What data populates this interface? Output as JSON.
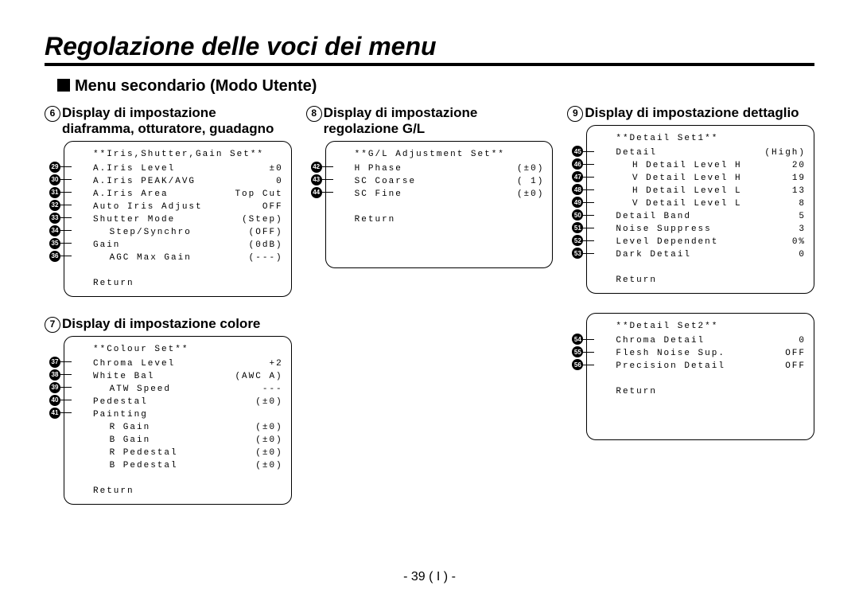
{
  "title": "Regolazione delle voci dei menu",
  "subhead": "Menu secondario (Modo Utente)",
  "footer": "- 39 ( I ) -",
  "sections": {
    "s6": {
      "num": "6",
      "title": "Display di impostazione diaframma, otturatore, guadagno",
      "header": "**Iris,Shutter,Gain Set**",
      "rows": [
        {
          "m": "29",
          "l": "A.Iris Level",
          "v": "±0"
        },
        {
          "m": "30",
          "l": "A.Iris PEAK/AVG",
          "v": "0"
        },
        {
          "m": "31",
          "l": "A.Iris Area",
          "v": "Top Cut"
        },
        {
          "m": "32",
          "l": "Auto Iris Adjust",
          "v": "OFF"
        },
        {
          "m": "33",
          "l": "Shutter Mode",
          "v": "(Step)"
        },
        {
          "m": "34",
          "l": " Step/Synchro",
          "v": "(OFF)",
          "indent": true
        },
        {
          "m": "35",
          "l": "Gain",
          "v": "(0dB)"
        },
        {
          "m": "36",
          "l": " AGC Max Gain",
          "v": "(---)",
          "indent": true
        }
      ],
      "return": "Return"
    },
    "s7": {
      "num": "7",
      "title": "Display di impostazione colore",
      "header": "**Colour Set**",
      "rows": [
        {
          "m": "37",
          "l": "Chroma Level",
          "v": "+2"
        },
        {
          "m": "38",
          "l": "White Bal",
          "v": "(AWC A)"
        },
        {
          "m": "39",
          "l": " ATW Speed",
          "v": "---",
          "indent": true
        },
        {
          "m": "40",
          "l": "Pedestal",
          "v": "(±0)"
        },
        {
          "m": "41",
          "l": "Painting",
          "v": ""
        },
        {
          "m": "",
          "l": " R Gain",
          "v": "(±0)",
          "indent": true
        },
        {
          "m": "",
          "l": " B Gain",
          "v": "(±0)",
          "indent": true
        },
        {
          "m": "",
          "l": " R Pedestal",
          "v": "(±0)",
          "indent": true
        },
        {
          "m": "",
          "l": " B Pedestal",
          "v": "(±0)",
          "indent": true
        }
      ],
      "return": "Return"
    },
    "s8": {
      "num": "8",
      "title": "Display di impostazione regolazione G/L",
      "header": "**G/L Adjustment Set**",
      "rows": [
        {
          "m": "42",
          "l": "H Phase",
          "v": "(±0)"
        },
        {
          "m": "43",
          "l": "SC Coarse",
          "v": "( 1)"
        },
        {
          "m": "44",
          "l": "SC Fine",
          "v": "(±0)"
        }
      ],
      "return": "Return"
    },
    "s9a": {
      "num": "9",
      "title": "Display di impostazione dettaglio",
      "header": "**Detail Set1**",
      "rows": [
        {
          "m": "45",
          "l": "Detail",
          "v": "(High)"
        },
        {
          "m": "46",
          "l": " H Detail Level H",
          "v": "20",
          "indent": true
        },
        {
          "m": "47",
          "l": " V Detail Level H",
          "v": "19",
          "indent": true
        },
        {
          "m": "48",
          "l": " H Detail Level L",
          "v": "13",
          "indent": true
        },
        {
          "m": "49",
          "l": " V Detail Level L",
          "v": "8",
          "indent": true
        },
        {
          "m": "50",
          "l": "Detail Band",
          "v": "5"
        },
        {
          "m": "51",
          "l": "Noise Suppress",
          "v": "3"
        },
        {
          "m": "52",
          "l": "Level Dependent",
          "v": "0%"
        },
        {
          "m": "53",
          "l": "Dark Detail",
          "v": "0"
        }
      ],
      "return": "Return"
    },
    "s9b": {
      "header": "**Detail Set2**",
      "rows": [
        {
          "m": "54",
          "l": "Chroma Detail",
          "v": "0"
        },
        {
          "m": "55",
          "l": "Flesh Noise Sup.",
          "v": "OFF"
        },
        {
          "m": "56",
          "l": "Precision Detail",
          "v": "OFF"
        }
      ],
      "return": "Return"
    }
  }
}
